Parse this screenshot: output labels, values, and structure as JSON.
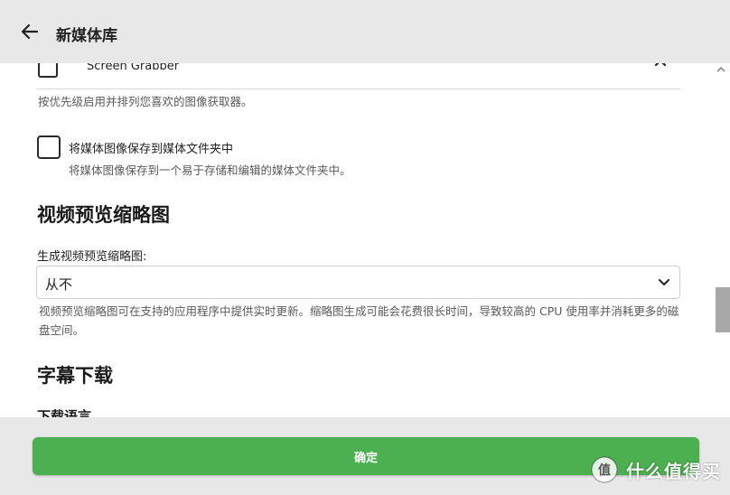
{
  "header": {
    "title": "新媒体库"
  },
  "plugins": {
    "screen_grabber_name": "Screen Grabber",
    "grabbers_helper": "按优先级启用并排列您喜欢的图像获取器。"
  },
  "save_media": {
    "label": "将媒体图像保存到媒体文件夹中",
    "helper": "将媒体图像保存到一个易于存储和编辑的媒体文件夹中。"
  },
  "video_thumbnails": {
    "section_title": "视频预览缩略图",
    "field_label": "生成视频预览缩略图:",
    "selected": "从不",
    "helper": "视频预览缩略图可在支持的应用程序中提供实时更新。缩略图生成可能会花费很长时间，导致较高的 CPU 使用率并消耗更多的磁盘空间。"
  },
  "subtitles": {
    "section_title": "字幕下载",
    "download_languages_label": "下载语言"
  },
  "footer": {
    "ok_label": "确定"
  },
  "watermark": {
    "text": "什么值得买",
    "logo_glyph": "值"
  },
  "colors": {
    "accent": "#4caf50",
    "header_bg": "#e8e8e8"
  }
}
